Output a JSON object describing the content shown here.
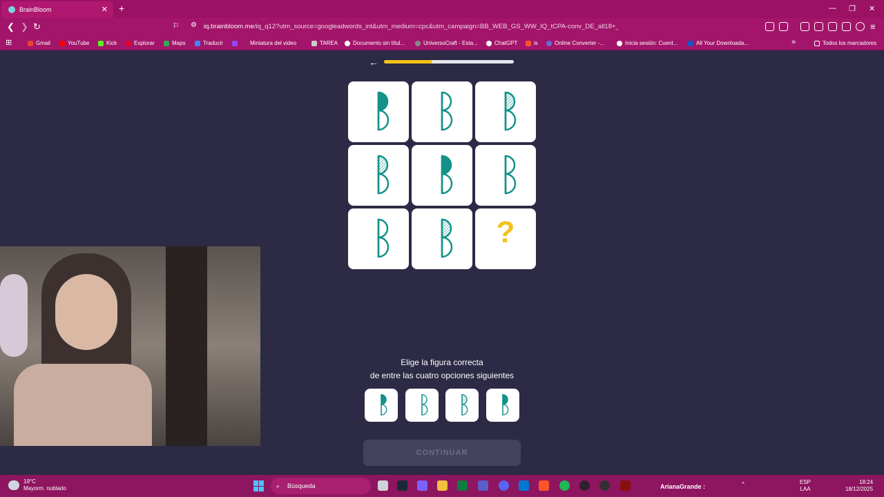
{
  "browser": {
    "tab_title": "BrainBloom",
    "url_domain": "iq.brainbloom.me",
    "url_rest": "/iq_q12?utm_source=googleadwords_int&utm_medium=cpc&utm_campaign=BB_WEB_GS_WW_IQ_tCPA-conv_DE_all18+_bro...",
    "bookmarks": [
      "Gmail",
      "YouTube",
      "Kick",
      "Explorar",
      "Maps",
      "Traducir",
      "Miniatura del video",
      "TAREA",
      "Documento sin títul...",
      "UniversoCraft - Esta...",
      "ChatGPT",
      "is",
      "Online Converter -...",
      "Inicia sesión: Cuent...",
      "All Your Downloada..."
    ],
    "all_bookmarks": "Todos los marcadores"
  },
  "quiz": {
    "progress": 0.37,
    "question_mark": "?",
    "instruction_line1": "Elige la figura correcta",
    "instruction_line2": "de entre las cuatro opciones siguientes",
    "continue_label": "CONTINUAR",
    "accent_color": "#13928a",
    "progress_color": "#f3c21b"
  },
  "taskbar": {
    "temperature": "19°C",
    "weather": "Mayorm. nublado",
    "search_placeholder": "Búsqueda",
    "now_playing": "ArianaGrande :",
    "lang": "ESP",
    "lang_sub": "LAA",
    "time": "18:24",
    "date": "18/12/2025"
  }
}
